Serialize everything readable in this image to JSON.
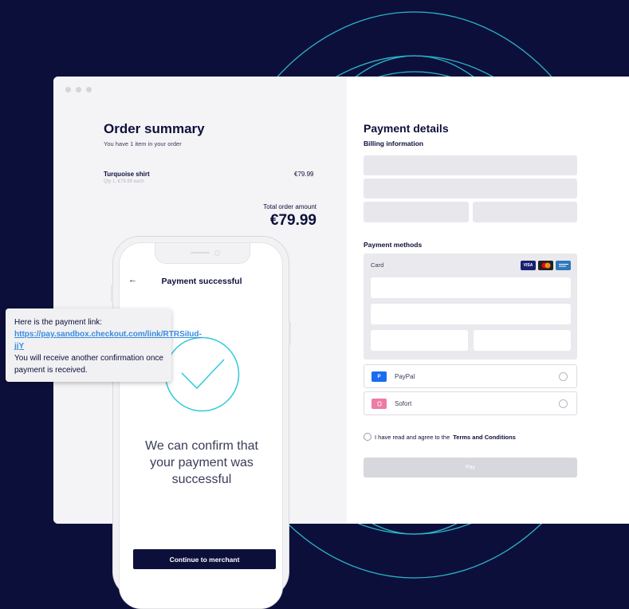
{
  "order_summary": {
    "title": "Order summary",
    "subtitle": "You have 1 item in your order",
    "item": {
      "name": "Turquoise shirt",
      "qty": "Qty 1, €79.99 each",
      "price": "€79.99"
    },
    "total_label": "Total order amount",
    "total_amount": "€79.99"
  },
  "payment_details": {
    "title": "Payment details",
    "billing_label": "Billing information",
    "methods_label": "Payment methods",
    "card_label": "Card",
    "card_logos": [
      {
        "name": "VISA",
        "color": "#1a1f71"
      },
      {
        "name": "",
        "color": "#222222"
      },
      {
        "name": "",
        "color": "#2e77bb"
      }
    ],
    "paypal_label": "PayPal",
    "sofort_label": "Sofort",
    "terms_prefix": "I have read and agree to the",
    "terms_link": "Terms and Conditions",
    "pay_label": "Pay"
  },
  "phone": {
    "title": "Payment successful",
    "confirm_text": "We can confirm that your payment was successful",
    "continue_label": "Continue to merchant"
  },
  "message": {
    "line1": "Here is the payment link:",
    "link": "https://pay.sandbox.checkout.com/link/RTRSiIud-jjY",
    "line2": "You will receive another confirmation once payment is received."
  },
  "colors": {
    "background": "#0d0f3b",
    "accent_ring": "#2fc9d8",
    "check": "#2fc9d8",
    "link": "#3a8ce0"
  }
}
